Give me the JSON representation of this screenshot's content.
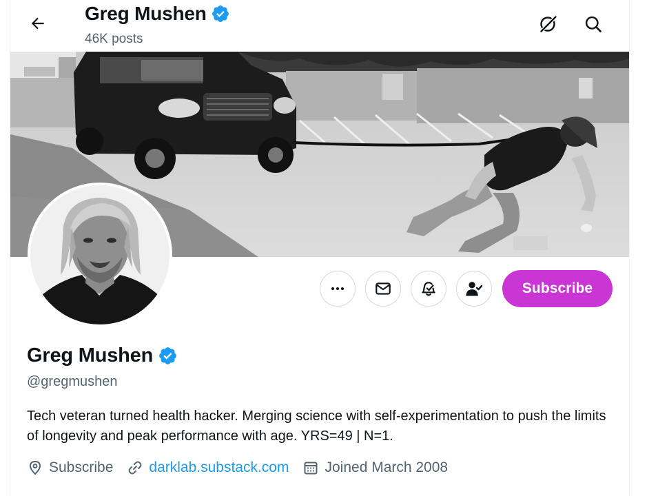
{
  "header": {
    "name": "Greg Mushen",
    "posts": "46K posts",
    "back_icon": "arrow-left-icon",
    "grok_icon": "grok-icon",
    "search_icon": "search-icon"
  },
  "profile": {
    "name": "Greg Mushen",
    "handle": "@gregmushen",
    "verified": true,
    "bio": "Tech veteran turned health hacker. Merging science with self-experimentation to push the limits of longevity and peak performance with age. YRS=49 | N=1.",
    "location": "Subscribe",
    "website": "darklab.substack.com",
    "joined": "Joined March 2008"
  },
  "actions": {
    "more_icon": "more-icon",
    "message_icon": "envelope-icon",
    "notify_icon": "bell-check-icon",
    "following_icon": "person-check-icon",
    "subscribe_label": "Subscribe"
  },
  "colors": {
    "verified": "#1d9bf0",
    "subscribe_bg": "#c936d3",
    "link": "#1d9bf0",
    "secondary_text": "#536471"
  }
}
